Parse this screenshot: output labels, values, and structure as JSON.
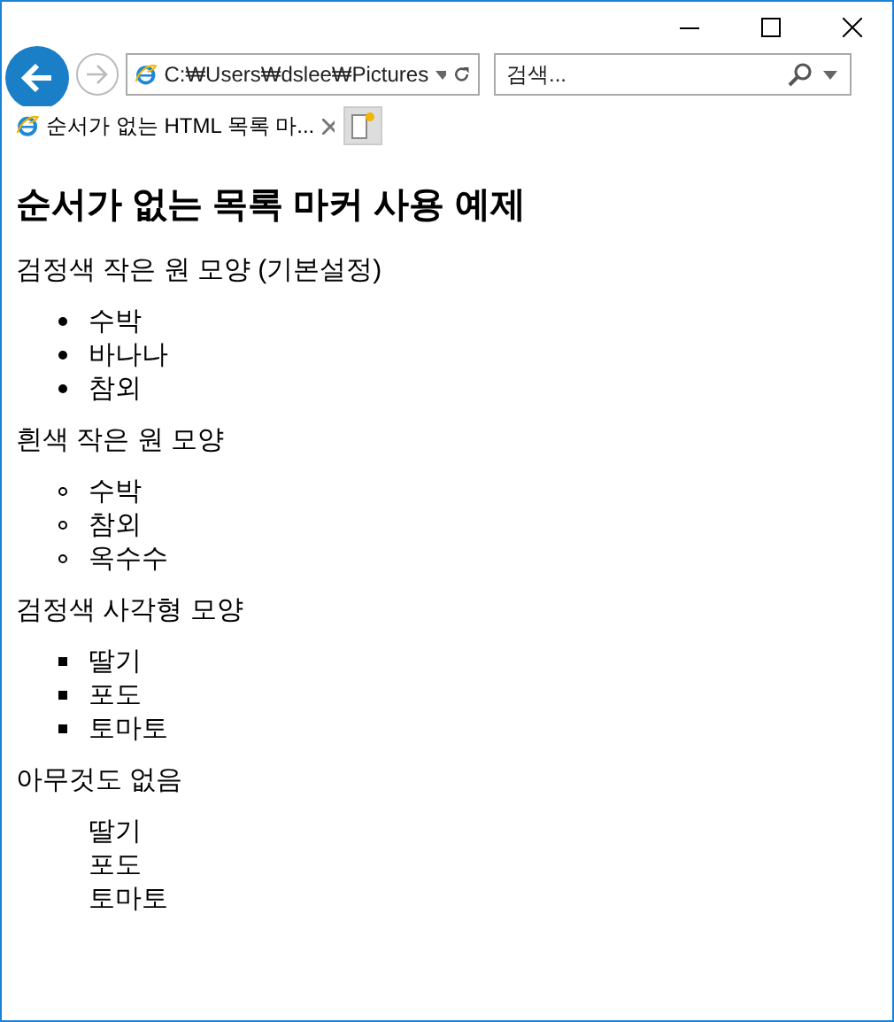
{
  "browser": {
    "address": "C:₩Users₩dslee₩Pictures",
    "search": {
      "placeholder": "검색..."
    },
    "tabs": [
      {
        "label": "순서가 없는 HTML 목록 마...",
        "selected": true
      }
    ]
  },
  "page": {
    "heading": "순서가 없는 목록 마커 사용 예제",
    "sections": [
      {
        "caption": "검정색 작은 원 모양 (기본설정)",
        "kind": "disc",
        "items": [
          "수박",
          "바나나",
          "참외"
        ]
      },
      {
        "caption": "흰색 작은 원 모양",
        "kind": "circle",
        "items": [
          "수박",
          "참외",
          "옥수수"
        ]
      },
      {
        "caption": "검정색 사각형 모양",
        "kind": "square",
        "items": [
          "딸기",
          "포도",
          "토마토"
        ]
      },
      {
        "caption": "아무것도 없음",
        "kind": "none",
        "items": [
          "딸기",
          "포도",
          "토마토"
        ]
      }
    ]
  }
}
